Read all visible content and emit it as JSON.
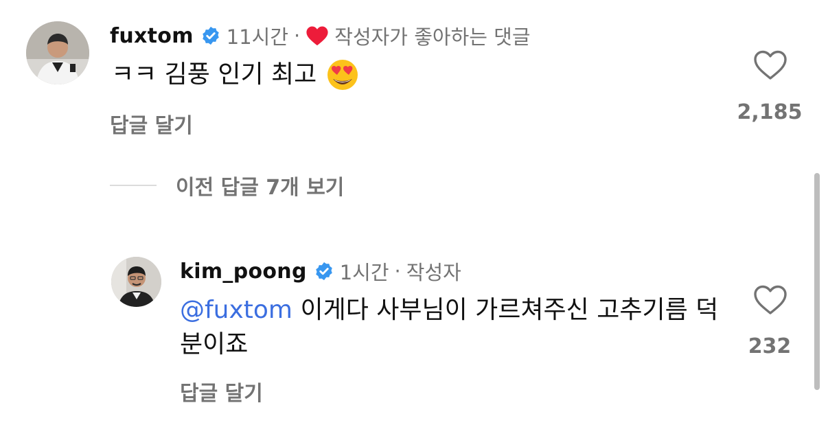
{
  "comments": [
    {
      "username": "fuxtom",
      "time": "11시간",
      "separator": "·",
      "liked_by_author_text": "작성자가 좋아하는 댓글",
      "text": "ㅋㅋ 김풍 인기 최고",
      "emoji": "smiling-face-with-heart-eyes",
      "like_count": "2,185",
      "reply_label": "답글 달기"
    },
    {
      "username": "kim_poong",
      "time": "1시간",
      "separator": "·",
      "author_tag": "작성자",
      "mention": "@fuxtom",
      "text": " 이게다 사부님이 가르쳐주신 고추기름 덕분이죠",
      "like_count": "232",
      "reply_label": "답글 달기"
    }
  ],
  "view_previous_replies": "이전 답글 7개 보기",
  "colors": {
    "verified": "#3897f0",
    "liked_heart": "#ed1c3a",
    "secondary_text": "#737373",
    "mention": "#3b6ee0"
  }
}
